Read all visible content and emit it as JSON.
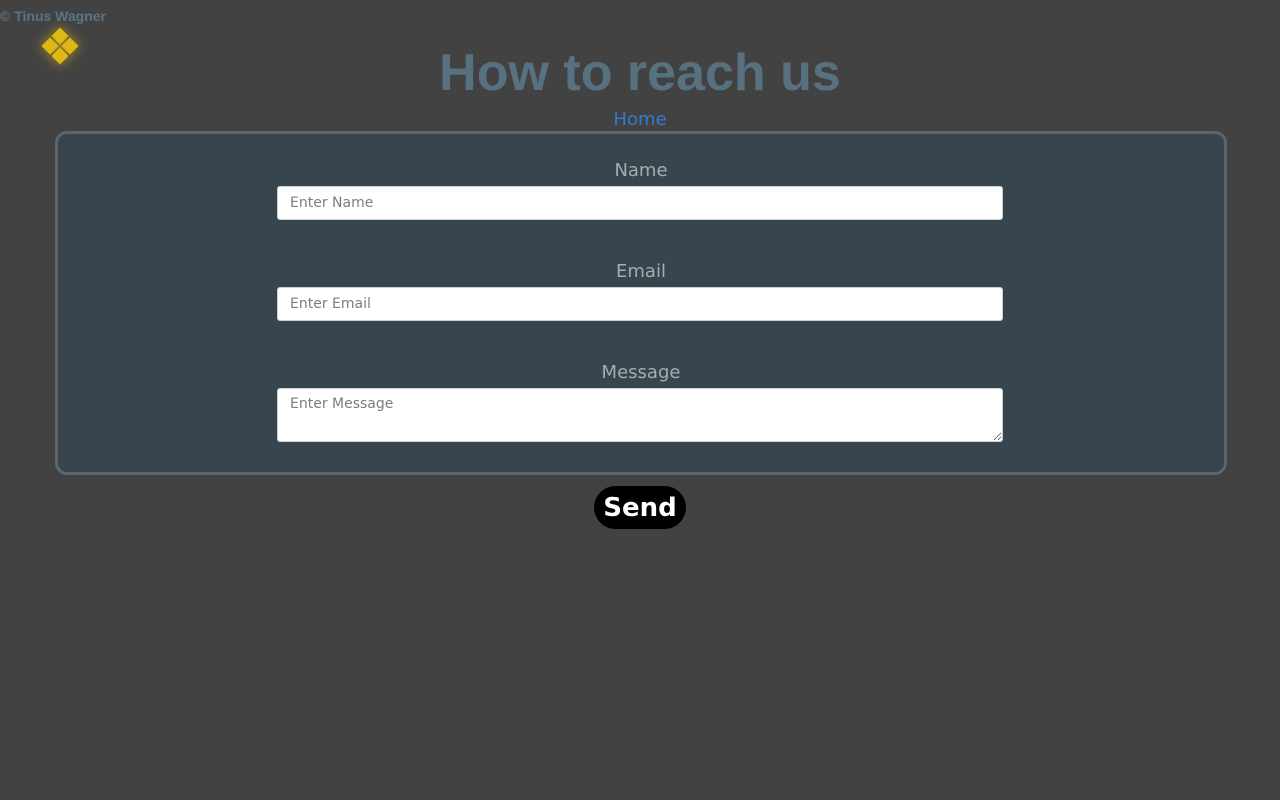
{
  "header": {
    "copyright": "© Tinus Wagner",
    "logo_icon": "diamond-cluster-logo-icon",
    "title": "How to reach us",
    "home_link": "Home"
  },
  "form": {
    "name": {
      "label": "Name",
      "placeholder": "Enter Name"
    },
    "email": {
      "label": "Email",
      "placeholder": "Enter Email"
    },
    "message": {
      "label": "Message",
      "placeholder": "Enter Message"
    },
    "submit_label": "Send"
  },
  "colors": {
    "background": "#424242",
    "panel": "#37454e",
    "title": "#587181",
    "link": "#2e7bd0",
    "logo": "#e0b814",
    "button": "#000000"
  }
}
